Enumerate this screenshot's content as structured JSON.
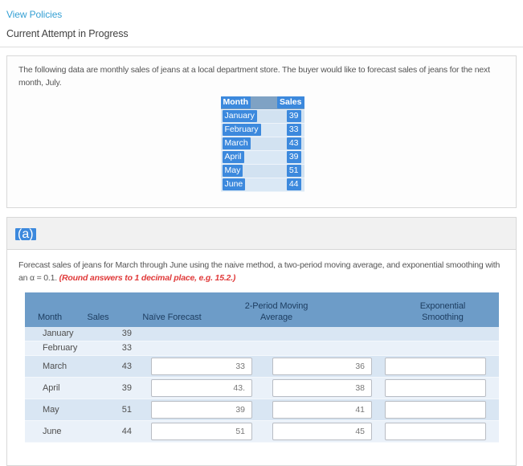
{
  "header": {
    "view_policies_label": "View Policies",
    "attempt_status": "Current Attempt in Progress"
  },
  "problem": {
    "statement": "The following data are monthly sales of jeans at a local department store. The buyer would like to forecast sales of jeans for the next month, July.",
    "data_table": {
      "columns": [
        "Month",
        "Sales"
      ],
      "rows": [
        [
          "January",
          "39"
        ],
        [
          "February",
          "33"
        ],
        [
          "March",
          "43"
        ],
        [
          "April",
          "39"
        ],
        [
          "May",
          "51"
        ],
        [
          "June",
          "44"
        ]
      ]
    }
  },
  "part_a": {
    "label": "(a)",
    "instruction": "Forecast sales of jeans for March through June using the naive method, a two-period moving average, and exponential smoothing with an α = 0.1. ",
    "note": "(Round answers to 1 decimal place, e.g. 15.2.)",
    "table": {
      "headers": {
        "month": "Month",
        "sales": "Sales",
        "naive": "Naïve Forecast",
        "moving": "2-Period Moving Average",
        "exp": "Exponential Smoothing"
      },
      "rows": [
        {
          "month": "January",
          "sales": "39"
        },
        {
          "month": "February",
          "sales": "33"
        },
        {
          "month": "March",
          "sales": "43",
          "naive": "33",
          "moving": "36",
          "exp": ""
        },
        {
          "month": "April",
          "sales": "39",
          "naive": "43.",
          "moving": "38",
          "exp": ""
        },
        {
          "month": "May",
          "sales": "51",
          "naive": "39",
          "moving": "41",
          "exp": ""
        },
        {
          "month": "June",
          "sales": "44",
          "naive": "51",
          "moving": "45",
          "exp": ""
        }
      ]
    }
  },
  "colors": {
    "link_blue": "#35a0d4",
    "selection_highlight": "#3c89dd",
    "table_header_blue": "#6d9cc8",
    "mini_header_blue": "#7fa2c4",
    "row_odd_blue": "#d9e6f3",
    "row_even_blue": "#eaf1f9",
    "note_red": "#e03a3a"
  }
}
